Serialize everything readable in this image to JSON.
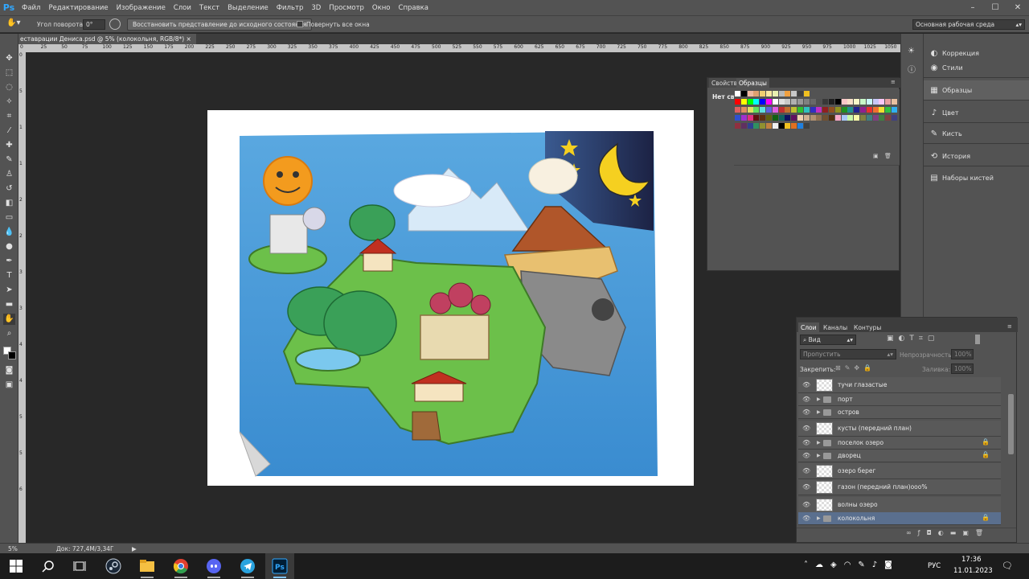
{
  "app": {
    "logo": "Ps"
  },
  "menu": [
    "Файл",
    "Редактирование",
    "Изображение",
    "Слои",
    "Текст",
    "Выделение",
    "Фильтр",
    "3D",
    "Просмотр",
    "Окно",
    "Справка"
  ],
  "window_controls": {
    "minimize": "–",
    "maximize": "☐",
    "close": "✕"
  },
  "options": {
    "rotate_label": "Угол поворота:",
    "rotate_value": "0°",
    "reset_view_button": "Восстановить представление до исходного состояния",
    "rotate_all_windows": "Повернуть все окна",
    "workspace": "Основная рабочая среда"
  },
  "document": {
    "title": "еставрации Дениса.psd @ 5% (колокольня, RGB/8*)",
    "close": "×"
  },
  "ruler_top": [
    "0",
    "25",
    "50",
    "75",
    "100",
    "125",
    "150",
    "175",
    "200",
    "225",
    "250",
    "275",
    "300",
    "325",
    "350",
    "375",
    "400",
    "425",
    "450",
    "475",
    "500",
    "525",
    "550",
    "575",
    "600",
    "625",
    "650",
    "675",
    "700",
    "725",
    "750",
    "775",
    "800",
    "825",
    "850",
    "875",
    "900",
    "925",
    "950",
    "975",
    "1000",
    "1025",
    "1050",
    "105"
  ],
  "ruler_left": [
    "0",
    "5",
    "1",
    "1",
    "2",
    "2",
    "3",
    "3",
    "4",
    "4",
    "5",
    "5",
    "6"
  ],
  "right_dock": {
    "items": [
      {
        "label": "Коррекция",
        "icon": "adjustments-icon"
      },
      {
        "label": "Стили",
        "icon": "styles-icon"
      },
      {
        "label": "Образцы",
        "icon": "swatches-icon"
      },
      {
        "label": "Цвет",
        "icon": "color-icon"
      },
      {
        "label": "Кисть",
        "icon": "brush-icon"
      },
      {
        "label": "История",
        "icon": "history-icon"
      },
      {
        "label": "Наборы кистей",
        "icon": "brush-presets-icon"
      }
    ]
  },
  "swatch_panel": {
    "tab_properties": "Свойств",
    "tab_swatches": "Образцы",
    "no_properties": "Нет сво",
    "colors": [
      [
        "#ffffff",
        "#000000",
        "#f0b8a0",
        "#e0a070",
        "#f0d070",
        "#f8e8a0",
        "#e8f0b0",
        "#b8b8b8",
        "#f0a040",
        "#c8c8c8",
        "#404040",
        "#f0c020"
      ],
      [
        "#ff0000",
        "#ffff00",
        "#00ff00",
        "#00ffff",
        "#0000ff",
        "#ff00ff",
        "#ffffff",
        "#e0e0e0",
        "#c8c8c8",
        "#b0b0b0",
        "#989898",
        "#808080",
        "#686868",
        "#505050",
        "#383838",
        "#202020",
        "#000000",
        "#f8c8c8",
        "#f8e0c8",
        "#f8f8c8",
        "#c8f8c8",
        "#c8f8f8",
        "#c8c8f8",
        "#f8c8f8",
        "#e8a0a0",
        "#e8c0a0"
      ],
      [
        "#e06060",
        "#e09060",
        "#e0e060",
        "#60e060",
        "#60e0e0",
        "#6060e0",
        "#e060e0",
        "#c03030",
        "#c07030",
        "#c0c030",
        "#30c030",
        "#30c0c0",
        "#3030c0",
        "#c030c0",
        "#902020",
        "#905020",
        "#909020",
        "#209020",
        "#209090",
        "#202090",
        "#902090",
        "#e83030",
        "#f07030",
        "#f0e030",
        "#30c040",
        "#30b0f0"
      ],
      [
        "#3050d0",
        "#a030d0",
        "#e03080",
        "#601010",
        "#603010",
        "#606010",
        "#106010",
        "#106060",
        "#101060",
        "#601060",
        "#f0d0b0",
        "#d0b090",
        "#b09070",
        "#907050",
        "#705030",
        "#503010",
        "#f8a8c8",
        "#a8c8f8",
        "#c8f8a8",
        "#f8f8a8",
        "#808040",
        "#408080",
        "#804080",
        "#408040",
        "#804040",
        "#404080"
      ],
      [
        "#903040",
        "#603060",
        "#304090",
        "#309060",
        "#909030",
        "#c08040",
        "#f0f0f0",
        "#000000",
        "#f0c020",
        "#e07020",
        "#2080e0",
        "#404040"
      ]
    ]
  },
  "layers_panel": {
    "tab_layers": "Слои",
    "tab_channels": "Каналы",
    "tab_paths": "Контуры",
    "filter_kind": "Вид",
    "blend_mode": "Пропустить",
    "opacity_label": "Непрозрачность:",
    "opacity_value": "100%",
    "lock_label": "Закрепить:",
    "fill_label": "Заливка:",
    "fill_value": "100%",
    "layers": [
      {
        "name": "тучи глазастые",
        "type": "layer",
        "locked": false
      },
      {
        "name": "порт",
        "type": "group",
        "locked": false
      },
      {
        "name": "остров",
        "type": "group",
        "locked": false
      },
      {
        "name": "кусты (передний план)",
        "type": "layer",
        "locked": false
      },
      {
        "name": "поселок озеро",
        "type": "group",
        "locked": true
      },
      {
        "name": "дворец",
        "type": "group",
        "locked": true
      },
      {
        "name": "озеро берег",
        "type": "layer",
        "locked": false
      },
      {
        "name": "газон (передний план)ооо%",
        "type": "layer",
        "locked": false
      },
      {
        "name": "волны озеро",
        "type": "layer",
        "locked": false
      },
      {
        "name": "колокольня",
        "type": "group",
        "locked": true,
        "selected": true
      }
    ]
  },
  "statusbar": {
    "zoom": "5%",
    "doc_info": "Док: 727,4M/3,34Г",
    "arrow": "▶"
  },
  "taskbar": {
    "apps": [
      "windows-start-icon",
      "search-icon",
      "task-view-icon",
      "steam-icon",
      "file-explorer-icon",
      "chrome-icon",
      "discord-icon",
      "telegram-icon",
      "photoshop-icon"
    ],
    "language": "РУС",
    "time": "17:36",
    "date": "11.01.2023"
  }
}
